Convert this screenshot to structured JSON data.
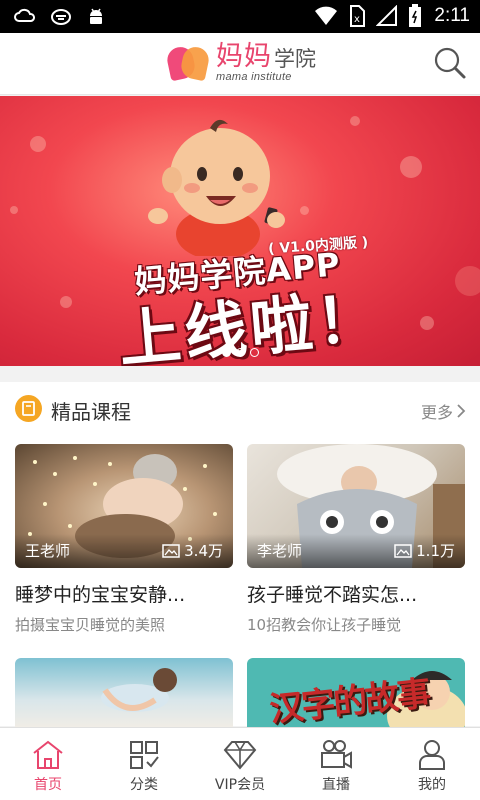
{
  "status_bar": {
    "time": "2:11",
    "battery_level": 0.7
  },
  "header": {
    "logo_cn_main": "妈妈",
    "logo_cn_suffix": "学院",
    "logo_en": "mama institute"
  },
  "banner": {
    "version": "( V1.0内测版 )",
    "line1": "妈妈学院APP",
    "line2": "上线啦！",
    "page_count": 3,
    "active_page": 1
  },
  "section": {
    "title": "精品课程",
    "more_label": "更多"
  },
  "courses": [
    {
      "teacher": "王老师",
      "views": "3.4万",
      "title": "睡梦中的宝宝安静...",
      "subtitle": "拍摄宝宝贝睡觉的美照"
    },
    {
      "teacher": "李老师",
      "views": "1.1万",
      "title": "孩子睡觉不踏实怎...",
      "subtitle": "10招教会你让孩子睡觉"
    }
  ],
  "partial_card_text": "汉字的故事",
  "tabs": [
    {
      "label": "首页",
      "icon": "home-icon",
      "active": true
    },
    {
      "label": "分类",
      "icon": "category-icon",
      "active": false
    },
    {
      "label": "VIP会员",
      "icon": "diamond-icon",
      "active": false
    },
    {
      "label": "直播",
      "icon": "video-camera-icon",
      "active": false
    },
    {
      "label": "我的",
      "icon": "person-icon",
      "active": false
    }
  ],
  "colors": {
    "accent": "#e8456d",
    "brand_orange": "#f5a623",
    "banner_red": "#e43a4b"
  }
}
